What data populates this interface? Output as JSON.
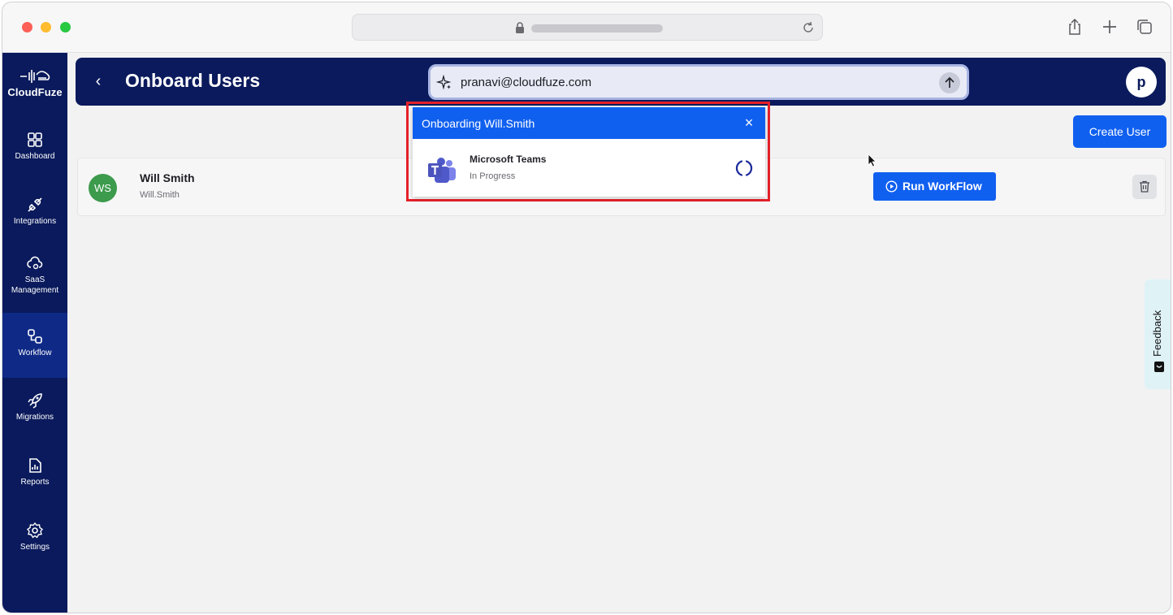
{
  "sidebar": {
    "brand": "CloudFuze",
    "items": [
      {
        "label": "Dashboard",
        "icon": "grid-icon"
      },
      {
        "label": "Integrations",
        "icon": "plug-icon"
      },
      {
        "label": "SaaS",
        "label2": "Management",
        "icon": "cloud-gear-icon"
      },
      {
        "label": "Workflow",
        "icon": "workflow-icon",
        "active": true
      },
      {
        "label": "Migrations",
        "icon": "rocket-icon"
      },
      {
        "label": "Reports",
        "icon": "report-icon"
      },
      {
        "label": "Settings",
        "icon": "gear-icon"
      }
    ]
  },
  "header": {
    "title": "Onboard Users",
    "ai_input_value": "pranavi@cloudfuze.com",
    "avatar_initial": "p"
  },
  "actions": {
    "create_user": "Create User"
  },
  "users": [
    {
      "initials": "WS",
      "name": "Will Smith",
      "username": "Will.Smith",
      "avatar_color": "#3c9b4c",
      "run_label": "Run WorkFlow"
    }
  ],
  "popup": {
    "title": "Onboarding Will.Smith",
    "task": {
      "app": "Microsoft Teams",
      "status": "In Progress",
      "icon": "microsoft-teams-icon"
    }
  },
  "feedback": {
    "label": "Feedback"
  },
  "colors": {
    "navy": "#0a1a5c",
    "primary_blue": "#1060f0",
    "highlight_red": "#e5212a"
  }
}
